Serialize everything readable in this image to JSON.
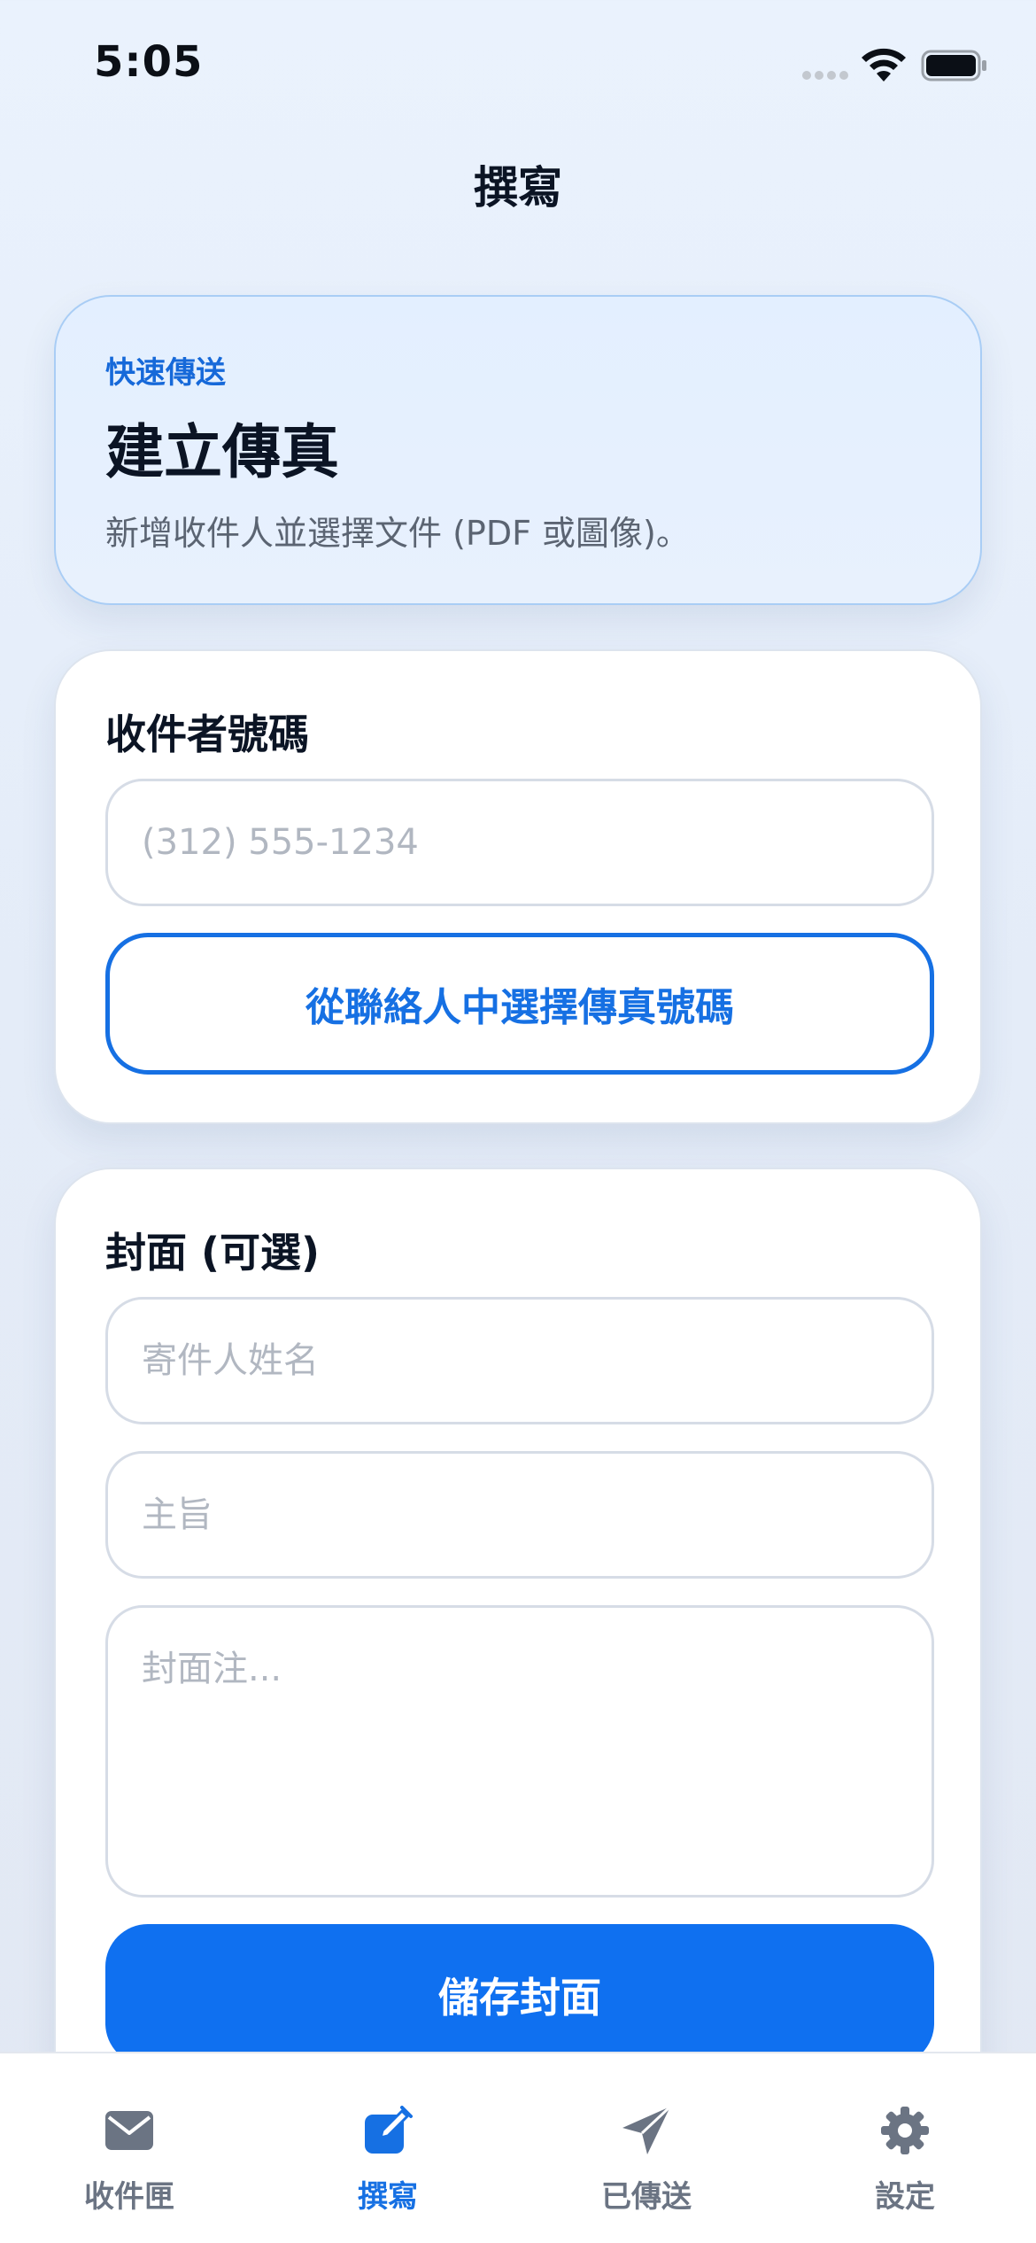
{
  "status_bar": {
    "time": "5:05"
  },
  "nav": {
    "title": "撰寫"
  },
  "hero": {
    "eyebrow": "快速傳送",
    "title": "建立傳真",
    "description": "新增收件人並選擇文件 (PDF 或圖像)。"
  },
  "recipient": {
    "label": "收件者號碼",
    "placeholder": "(312) 555-1234",
    "contacts_button": "從聯絡人中選擇傳真號碼"
  },
  "cover": {
    "label": "封面 (可選)",
    "sender_placeholder": "寄件人姓名",
    "subject_placeholder": "主旨",
    "notes_placeholder": "封面注...",
    "save_button": "儲存封面"
  },
  "tabs": [
    {
      "label": "收件匣",
      "icon": "envelope-icon",
      "active": false
    },
    {
      "label": "撰寫",
      "icon": "compose-icon",
      "active": true
    },
    {
      "label": "已傳送",
      "icon": "paper-plane-icon",
      "active": false
    },
    {
      "label": "設定",
      "icon": "gear-icon",
      "active": false
    }
  ],
  "colors": {
    "accent": "#1670e3",
    "primary_button": "#0f70f0",
    "inactive_tab": "#6b7483"
  }
}
